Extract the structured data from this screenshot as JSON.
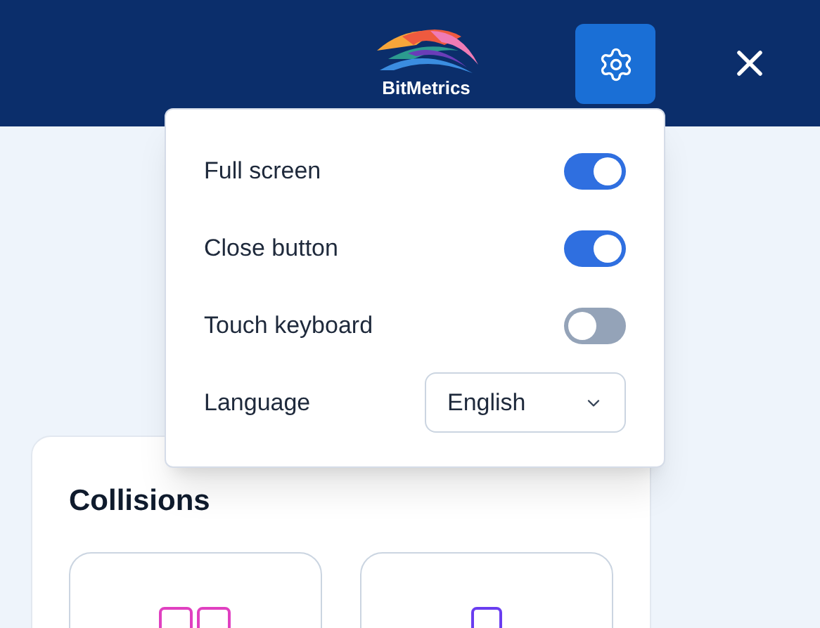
{
  "header": {
    "logo_text": "BitMetrics"
  },
  "settings_menu": {
    "rows": [
      {
        "kind": "toggle",
        "label": "Full screen",
        "on": true
      },
      {
        "kind": "toggle",
        "label": "Close button",
        "on": true
      },
      {
        "kind": "toggle",
        "label": "Touch keyboard",
        "on": false
      },
      {
        "kind": "select",
        "label": "Language",
        "value": "English"
      }
    ]
  },
  "card": {
    "title": "Collisions",
    "tiles": [
      {
        "color": "#e040c0",
        "kind": "double"
      },
      {
        "color": "#6a3df0",
        "kind": "single"
      }
    ]
  }
}
